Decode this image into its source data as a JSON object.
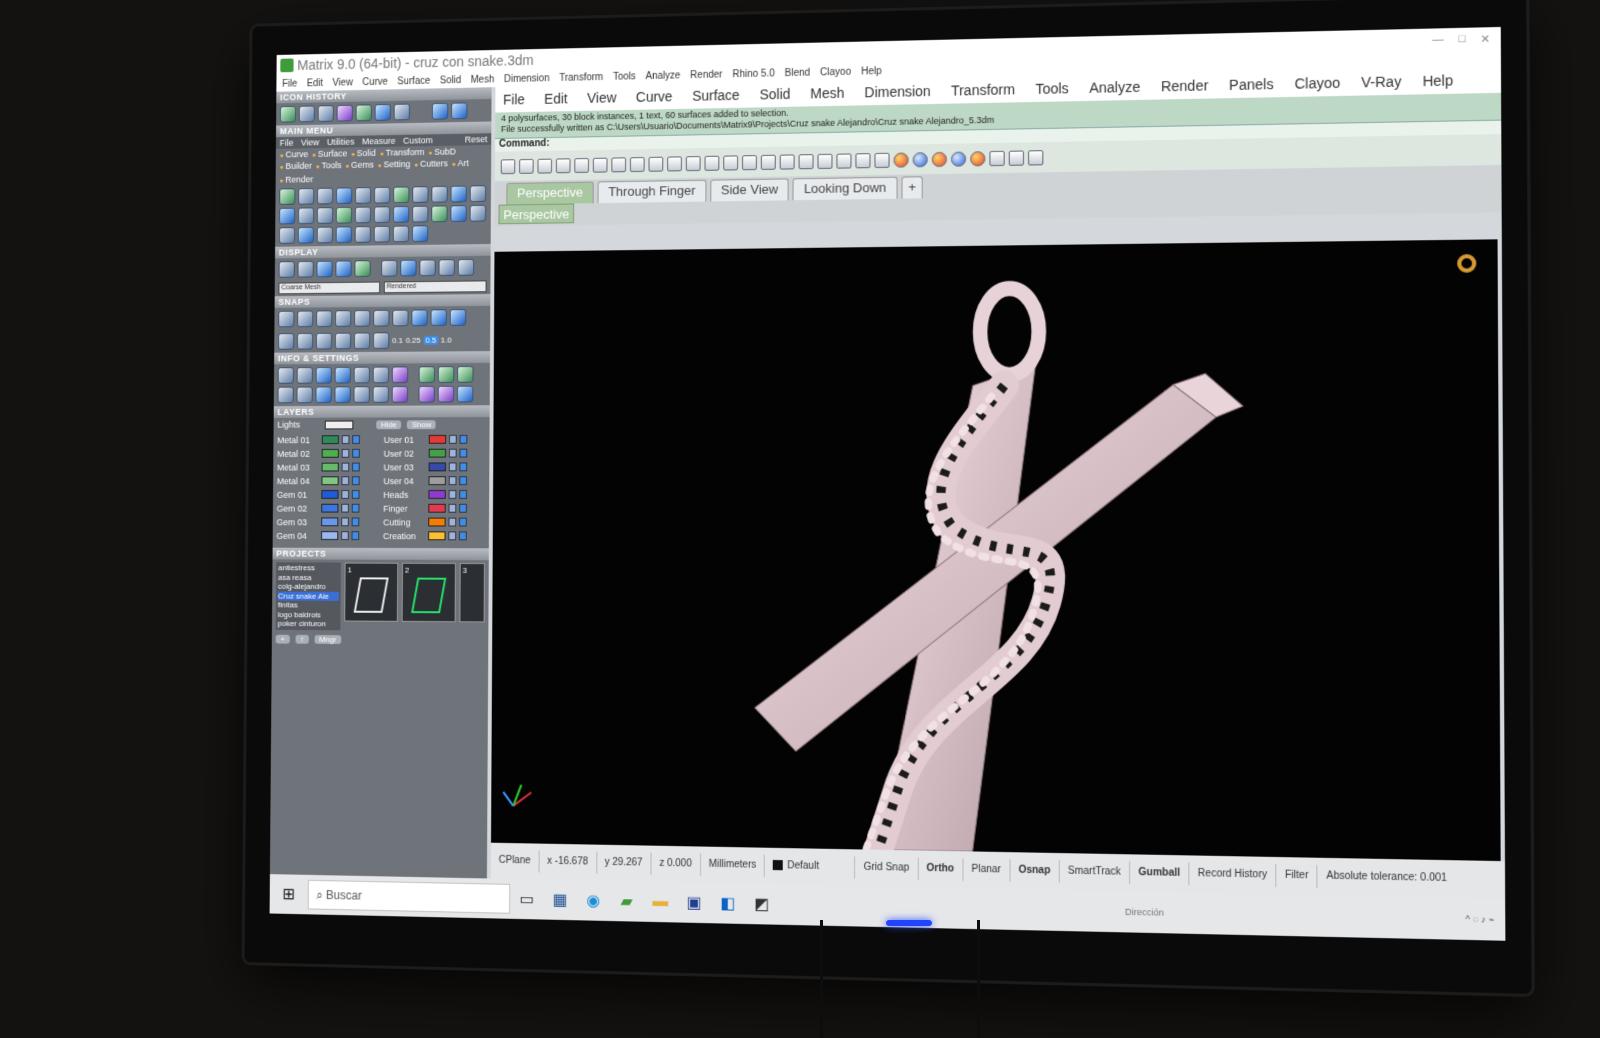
{
  "window": {
    "title": "Matrix 9.0 (64-bit) - cruz con snake.3dm",
    "small_menu": [
      "File",
      "Edit",
      "View",
      "Curve",
      "Surface",
      "Solid",
      "Mesh",
      "Dimension",
      "Transform",
      "Tools",
      "Analyze",
      "Render",
      "Rhino 5.0",
      "Blend",
      "Clayoo",
      "Help"
    ]
  },
  "left_panel": {
    "icon_history_title": "ICON HISTORY",
    "main_menu_title": "MAIN MENU",
    "main_menu_items": [
      "File",
      "View",
      "Utilities",
      "Measure",
      "Custom"
    ],
    "reset_label": "Reset",
    "category_row1": [
      "Curve",
      "Surface",
      "Solid",
      "Transform",
      "SubD"
    ],
    "category_row2": [
      "Builder",
      "Tools",
      "Gems",
      "Setting",
      "Cutters",
      "Art",
      "Render"
    ],
    "display_title": "DISPLAY",
    "display_select1": "Coarse Mesh",
    "display_select2": "Rendered",
    "snaps_title": "SNAPS",
    "snap_values": [
      "0.1",
      "0.25",
      "0.5",
      "1.0"
    ],
    "info_title": "INFO & SETTINGS",
    "layers_title": "LAYERS",
    "lights_label": "Lights",
    "hide_label": "Hide",
    "show_label": "Show",
    "layers_left": [
      {
        "name": "Metal 01",
        "color": "#2e8b57"
      },
      {
        "name": "Metal 02",
        "color": "#4caf50"
      },
      {
        "name": "Metal 03",
        "color": "#66bb6a"
      },
      {
        "name": "Metal 04",
        "color": "#81c784"
      },
      {
        "name": "Gem 01",
        "color": "#1e5bd8"
      },
      {
        "name": "Gem 02",
        "color": "#3a75e0"
      },
      {
        "name": "Gem 03",
        "color": "#6a97ea"
      },
      {
        "name": "Gem 04",
        "color": "#9ab7f0"
      }
    ],
    "layers_right": [
      {
        "name": "User 01",
        "color": "#e53935"
      },
      {
        "name": "User 02",
        "color": "#43a047"
      },
      {
        "name": "User 03",
        "color": "#3949ab"
      },
      {
        "name": "User 04",
        "color": "#9e9e9e"
      },
      {
        "name": "Heads",
        "color": "#8e3ad1"
      },
      {
        "name": "Finger",
        "color": "#e53950"
      },
      {
        "name": "Cutting",
        "color": "#f57c00"
      },
      {
        "name": "Creation",
        "color": "#fbc02d"
      }
    ],
    "projects_title": "PROJECTS",
    "projects": [
      "antiestress",
      "asa reasa",
      "colg-alejandro",
      "Cruz snake Ale",
      "finitas",
      "logo baldrois",
      "poker cinturon"
    ],
    "selected_project": "Cruz snake Ale",
    "project_thumbs": [
      "1",
      "2",
      "3"
    ],
    "project_btn": "Mngr"
  },
  "menubar": [
    "File",
    "Edit",
    "View",
    "Curve",
    "Surface",
    "Solid",
    "Mesh",
    "Dimension",
    "Transform",
    "Tools",
    "Analyze",
    "Render",
    "Panels",
    "Clayoo",
    "V-Ray",
    "Help"
  ],
  "command": {
    "history_line1": "4 polysurfaces, 30 block instances, 1 text, 60 surfaces added to selection.",
    "history_line2": "File successfully written as C:\\Users\\Usuario\\Documents\\Matrix9\\Projects\\Cruz snake Alejandro\\Cruz snake Alejandro_5.3dm",
    "prompt": "Command:"
  },
  "tabs": [
    "Perspective",
    "Through Finger",
    "Side View",
    "Looking Down",
    "+"
  ],
  "active_tab": "Perspective",
  "viewport_label": "Perspective",
  "status": {
    "cplane": "CPlane",
    "x": "x -16.678",
    "y": "y 29.267",
    "z": "z 0.000",
    "units": "Millimeters",
    "layer": "Default",
    "toggles": [
      "Grid Snap",
      "Ortho",
      "Planar",
      "Osnap",
      "SmartTrack",
      "Gumball",
      "Record History",
      "Filter"
    ],
    "tolerance": "Absolute tolerance: 0.001"
  },
  "taskbar": {
    "search_placeholder": "Buscar",
    "direction_label": "Dirección",
    "apps": [
      "task-view-icon",
      "calculator-icon",
      "edge-icon",
      "matrix-icon",
      "explorer-icon",
      "photoshop-icon",
      "outlook-icon",
      "app-icon"
    ]
  }
}
